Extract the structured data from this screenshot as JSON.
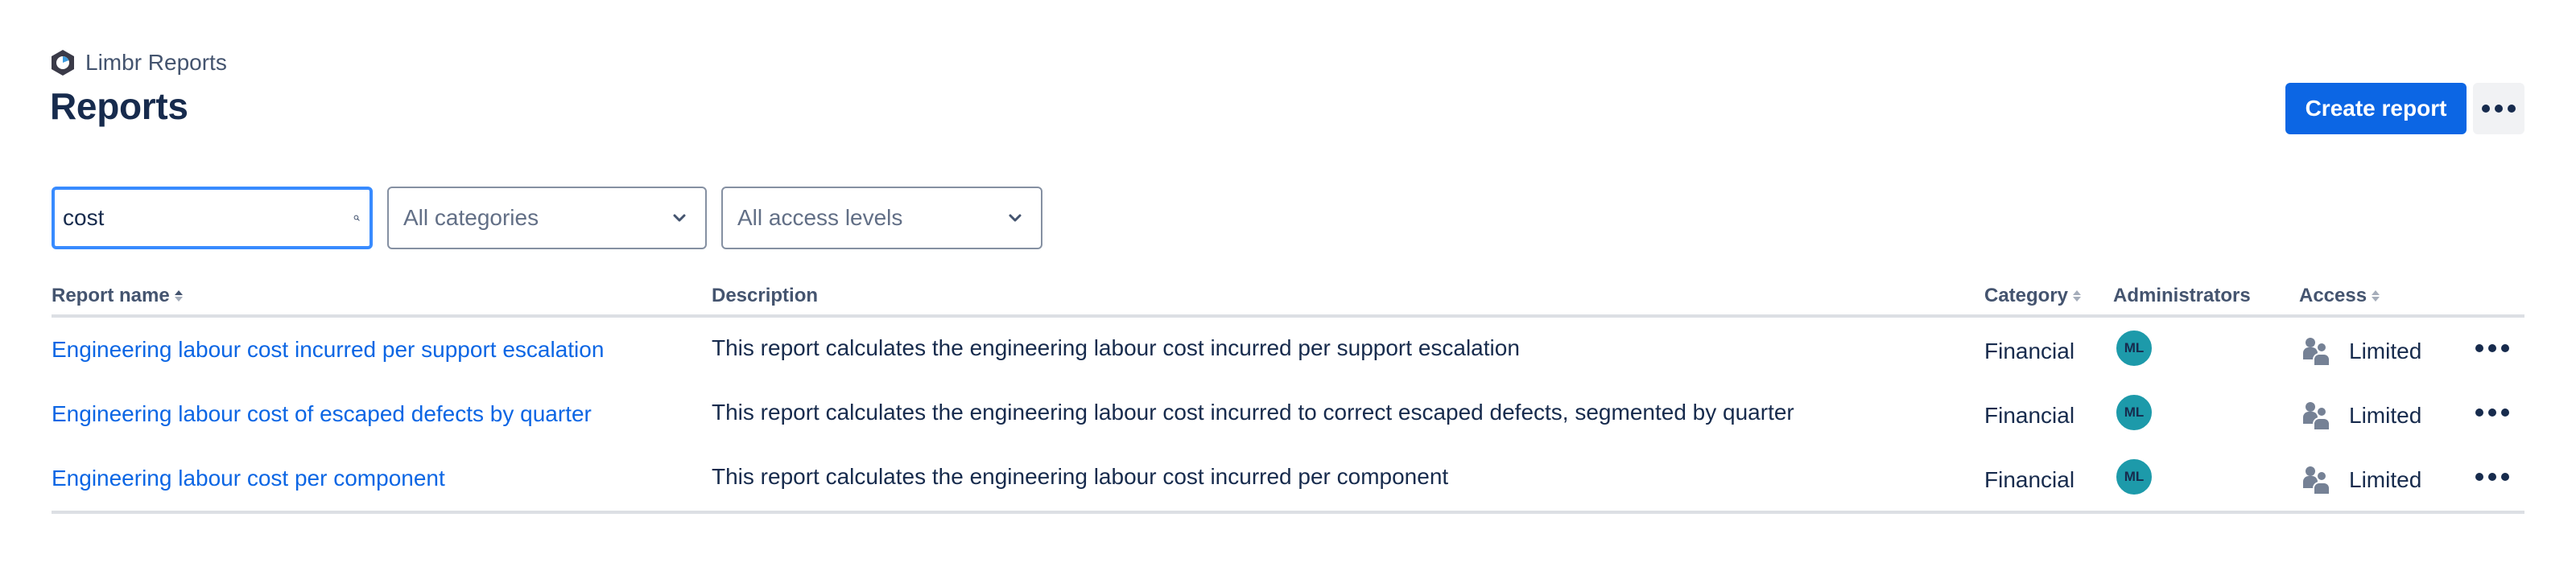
{
  "app": {
    "name": "Limbr Reports",
    "logo_icon": "limbr-hexagon-logo",
    "brand_colors": {
      "logo_dark": "#3A3A48",
      "logo_accent": "#3E9BDD"
    }
  },
  "header": {
    "title": "Reports",
    "actions": {
      "create_label": "Create report",
      "more_icon": "ellipsis-icon"
    }
  },
  "filters": {
    "search": {
      "value": "cost",
      "placeholder": "Search",
      "icon": "search-icon"
    },
    "category": {
      "selected": "All categories",
      "icon": "chevron-down-icon"
    },
    "access": {
      "selected": "All access levels",
      "icon": "chevron-down-icon"
    }
  },
  "table": {
    "columns": {
      "name": {
        "label": "Report name",
        "sortable": true,
        "sort": "ascending"
      },
      "description": {
        "label": "Description",
        "sortable": false
      },
      "category": {
        "label": "Category",
        "sortable": true,
        "sort": "none"
      },
      "administrators": {
        "label": "Administrators",
        "sortable": false
      },
      "access": {
        "label": "Access",
        "sortable": true,
        "sort": "none"
      }
    },
    "rows": [
      {
        "name": "Engineering labour cost incurred per support escalation",
        "description": "This report calculates the engineering labour cost incurred per support escalation",
        "category": "Financial",
        "admin_initials": "ML",
        "access": "Limited"
      },
      {
        "name": "Engineering labour cost of escaped defects by quarter",
        "description": "This report calculates the engineering labour cost incurred to correct escaped defects, segmented by quarter",
        "category": "Financial",
        "admin_initials": "ML",
        "access": "Limited"
      },
      {
        "name": "Engineering labour cost per component",
        "description": "This report calculates the engineering labour cost incurred per component",
        "category": "Financial",
        "admin_initials": "ML",
        "access": "Limited"
      }
    ]
  },
  "colors": {
    "primary": "#0C66E4",
    "link": "#0C66E4",
    "text": "#172B4D",
    "subtle_text": "#44546F",
    "avatar_bg": "#1D9AAA",
    "focus_border": "#388BFF",
    "border": "#DCDFE4",
    "icon_gray": "#758195"
  }
}
